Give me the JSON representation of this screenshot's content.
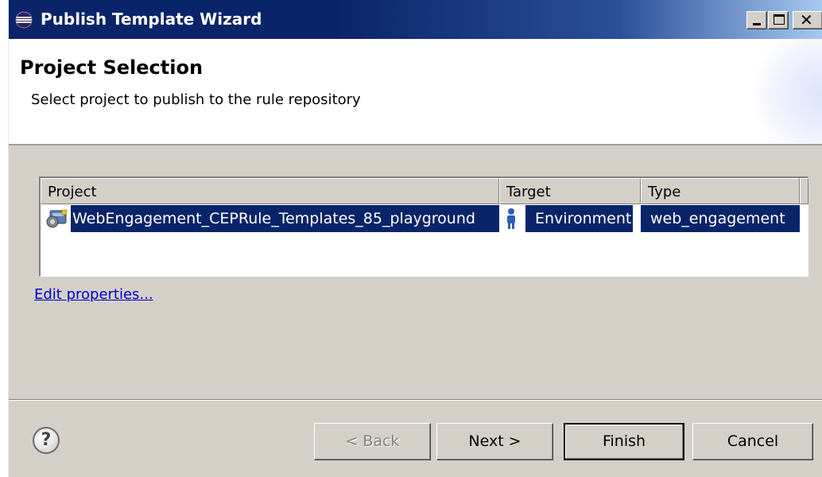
{
  "window": {
    "title": "Publish Template Wizard"
  },
  "header": {
    "title": "Project Selection",
    "description": "Select project to publish to the rule repository"
  },
  "table": {
    "columns": [
      "Project",
      "Target",
      "Type"
    ],
    "rows": [
      {
        "project": "WebEngagement_CEPRule_Templates_85_playground",
        "target": "Environment",
        "type": "web_engagement",
        "selected": true
      }
    ]
  },
  "links": {
    "edit_properties": "Edit properties..."
  },
  "buttons": {
    "back": "< Back",
    "next": "Next >",
    "finish": "Finish",
    "cancel": "Cancel"
  },
  "icons": {
    "title": "eclipse-icon",
    "project": "project-gear-icon",
    "target": "person-icon",
    "help": "help-icon"
  },
  "colors": {
    "titlebar": "#0a246a",
    "selection": "#0a246a",
    "dialog_bg": "#d4d0c8",
    "link": "#0000cc"
  }
}
